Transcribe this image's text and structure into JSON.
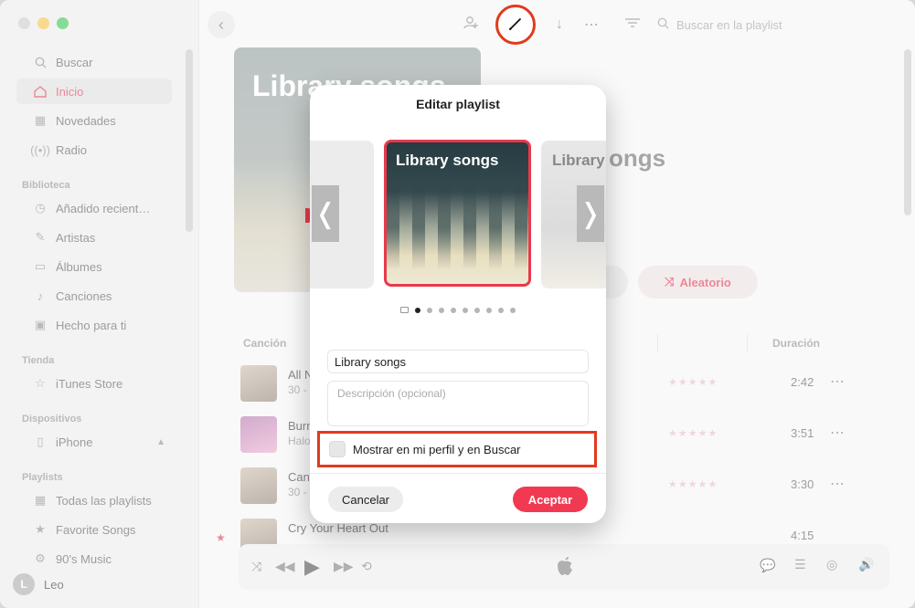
{
  "sidebar": {
    "search": "Buscar",
    "home": "Inicio",
    "new": "Novedades",
    "radio": "Radio",
    "library_title": "Biblioteca",
    "library": [
      "Añadido recient…",
      "Artistas",
      "Álbumes",
      "Canciones",
      "Hecho para ti"
    ],
    "store_title": "Tienda",
    "store": "iTunes Store",
    "devices_title": "Dispositivos",
    "device": "iPhone",
    "playlists_title": "Playlists",
    "playlists": [
      "Todas las playlists",
      "Favorite Songs",
      "90's Music"
    ],
    "user_initial": "L",
    "user_name": "Leo"
  },
  "toolbar": {
    "search_placeholder": "Buscar en la playlist",
    "back_icon": "‹"
  },
  "content": {
    "cover_title": "Library songs",
    "bg_title_fragment": "ongs",
    "shuffle_label": "Aleatorio",
    "col_song": "Canción",
    "col_duration": "Duración",
    "songs": [
      {
        "title": "All N",
        "sub": "30 -",
        "stars": "★★★★★",
        "duration": "2:42"
      },
      {
        "title": "Burn",
        "sub": "Halo",
        "stars": "★★★★★",
        "duration": "3:51"
      },
      {
        "title": "Can",
        "sub": "30 -",
        "stars": "★★★★★",
        "duration": "3:30"
      },
      {
        "title": "Cry Your Heart Out",
        "sub": "",
        "stars": "",
        "duration": "4:15"
      }
    ]
  },
  "modal": {
    "title": "Editar playlist",
    "art_main_title": "Library songs",
    "art_right_title": "Library",
    "name_value": "Library songs",
    "description_placeholder": "Descripción (opcional)",
    "share_label": "Mostrar en mi perfil y en Buscar",
    "cancel_label": "Cancelar",
    "ok_label": "Aceptar",
    "dots_count": 9,
    "active_dot": 0
  },
  "colors": {
    "accent": "#e0314b",
    "highlight": "#e03a1e",
    "ok_button": "#f13a52"
  }
}
